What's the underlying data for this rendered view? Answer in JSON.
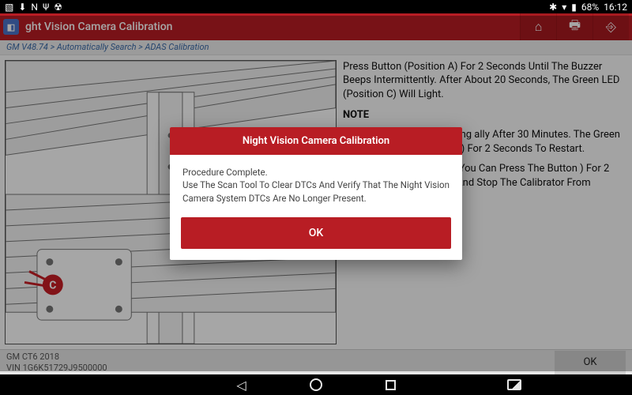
{
  "status": {
    "battery": "68%",
    "time": "16:12"
  },
  "header": {
    "title": "ght Vision Camera Calibration"
  },
  "breadcrumb": "GM V48.74 > Automatically Search > ADAS Calibration",
  "instructions": {
    "p1": "Press Button (Position A) For 2 Seconds Until The Buzzer Beeps Intermittently. After About 20 Seconds, The Green LED (Position C) Will Light.",
    "p2": "tor LAC06-01 Stops Working ally After 30 Minutes. The Green Off And Press The Button ) For 2 Seconds To Restart.",
    "p3": "mal Operation Of The NV You Can Press The Button ) For 2 Seconds To Turn Off Thr And Stop The Calibrator From Working."
  },
  "footer": {
    "vehicle": "GM CT6 2018",
    "vin": "VIN 1G6K51729J9500000",
    "ok": "OK"
  },
  "dialog": {
    "title": "Night Vision Camera Calibration",
    "line1": "Procedure Complete.",
    "line2": "Use The Scan Tool To Clear DTCs And Verify That The Night Vision Camera System DTCs Are No Longer Present.",
    "ok": "OK"
  }
}
